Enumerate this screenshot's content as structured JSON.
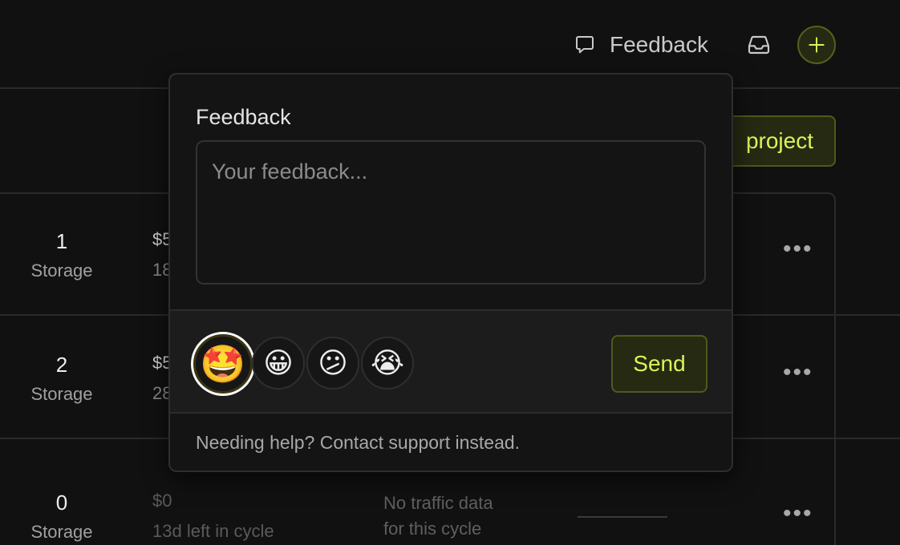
{
  "header": {
    "feedback_label": "Feedback",
    "inbox_icon": "inbox-icon",
    "add_icon": "plus-icon"
  },
  "toolbar": {
    "project_button_label": "project"
  },
  "rows": [
    {
      "count": "1",
      "label": "Storage",
      "cost": "$5",
      "cycle": "18"
    },
    {
      "count": "2",
      "label": "Storage",
      "cost": "$5",
      "cycle": "28"
    },
    {
      "count": "0",
      "label": "Storage",
      "cost": "$0",
      "cycle": "13d left in cycle",
      "traffic_line1": "No traffic data",
      "traffic_line2": "for this cycle"
    }
  ],
  "row_menu_glyph": "•••",
  "popover": {
    "title": "Feedback",
    "placeholder": "Your feedback...",
    "value": "",
    "emojis": [
      {
        "glyph": "🤩",
        "name": "star-struck",
        "selected": true
      },
      {
        "glyph": "😀",
        "name": "grinning",
        "selected": false
      },
      {
        "glyph": "😕",
        "name": "confused",
        "selected": false
      },
      {
        "glyph": "😭",
        "name": "crying",
        "selected": false
      }
    ],
    "send_label": "Send",
    "footer_prefix": "Needing help? ",
    "footer_link": "Contact support instead."
  },
  "colors": {
    "background": "#111111",
    "accent": "#d8f55a",
    "accent_bg": "#262a12"
  }
}
